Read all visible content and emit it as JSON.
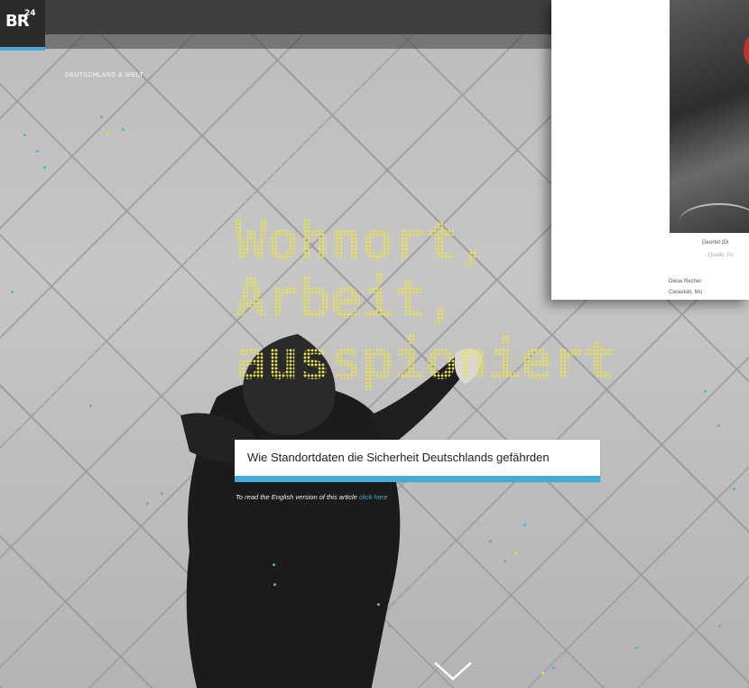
{
  "header": {
    "logo": {
      "text": "BR",
      "superscript": "24"
    },
    "breadcrumb": "DEUTSCHLAND & WELT"
  },
  "hero": {
    "headline_lines": [
      "Wohnort,",
      "Arbeit,",
      "ausspioniert"
    ],
    "subtitle": "Wie Standortdaten die Sicherheit Deutschlands gefährden",
    "english_note": "To read the English version of this article",
    "english_link": "click here",
    "scroll_icon": "chevron-down-icon"
  },
  "overlay_article": {
    "caption": "Geortet (Di",
    "caption_source": "- Quelle: Pu",
    "paragraph_line_1": "Diese Recher",
    "paragraph_line_2": "Ciesielski, Mo"
  },
  "colors": {
    "headline": "#e9e051",
    "accent": "#44abd8",
    "topbar": "#3f3f3f",
    "overlay_red": "#c0312b"
  }
}
